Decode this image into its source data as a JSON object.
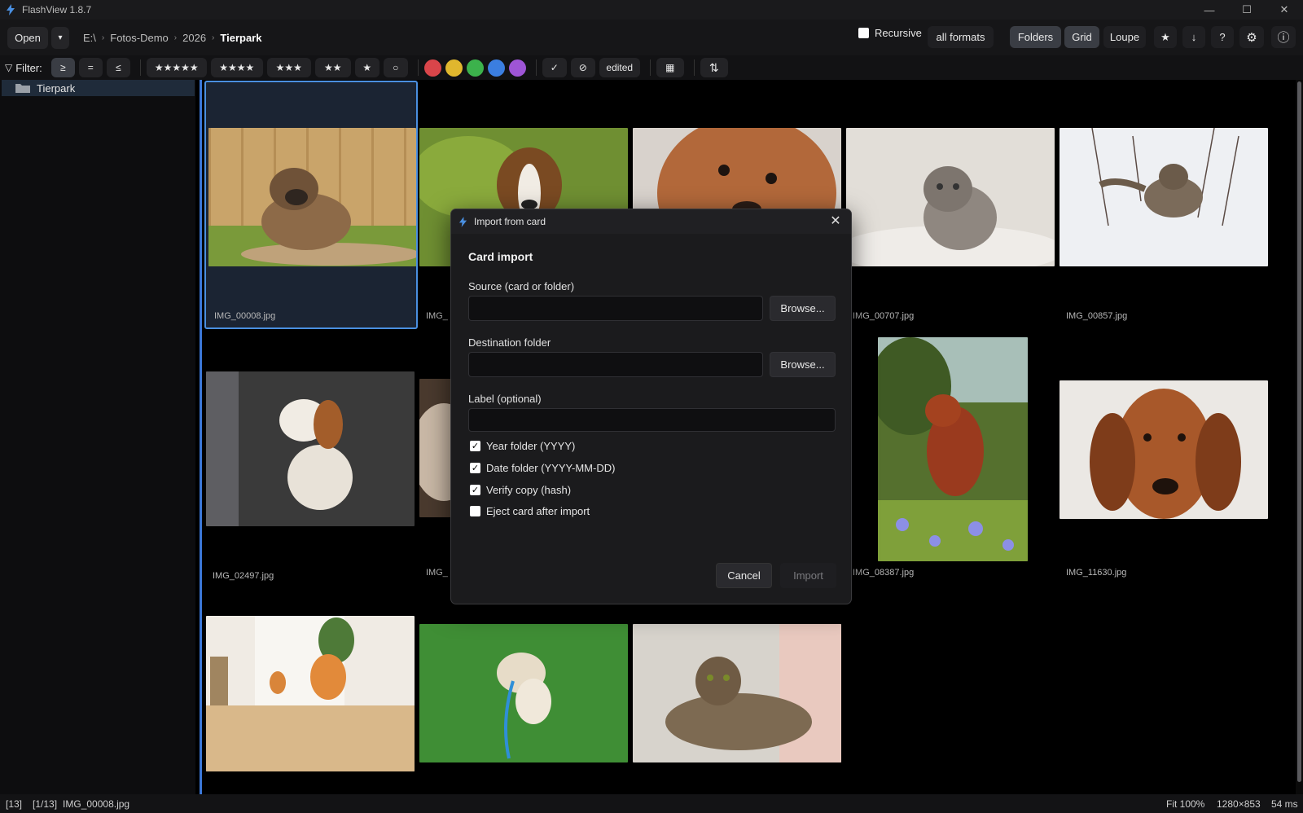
{
  "app": {
    "title": "FlashView 1.8.7"
  },
  "window_controls": {
    "minimize": "—",
    "maximize": "☐",
    "close": "✕"
  },
  "toolbar": {
    "open_label": "Open",
    "open_dropdown": "▾",
    "breadcrumbs": [
      "E:\\",
      "Fotos-Demo",
      "2026",
      "Tierpark"
    ],
    "breadcrumb_sep": "›",
    "recursive_label": "Recursive",
    "recursive_checked": false,
    "formats_label": "all formats",
    "folders_label": "Folders",
    "grid_label": "Grid",
    "loupe_label": "Loupe",
    "star_icon": "★",
    "download_icon": "↓",
    "help_icon": "?",
    "settings_icon": "⚙",
    "info_icon": "ⓘ"
  },
  "filter": {
    "label": "Filter:",
    "funnel_icon": "▽",
    "compare": [
      "≥",
      "=",
      "≤"
    ],
    "compare_active": "≥",
    "stars": [
      "★★★★★",
      "★★★★",
      "★★★",
      "★★",
      "★",
      "○"
    ],
    "colors": [
      "#d9454a",
      "#e0b72e",
      "#3cb24c",
      "#3b7ee0",
      "#9e55d6"
    ],
    "check_icon": "✓",
    "reject_icon": "⊘",
    "edited_label": "edited",
    "calendar_icon": "▦",
    "sort_icon": "⇅"
  },
  "sidebar": {
    "items": [
      {
        "label": "Tierpark"
      }
    ]
  },
  "grid": {
    "items": [
      {
        "name": "IMG_00008.jpg",
        "selected": true
      },
      {
        "name": "IMG_"
      },
      {
        "name": ""
      },
      {
        "name": "IMG_00707.jpg"
      },
      {
        "name": "IMG_00857.jpg"
      },
      {
        "name": "IMG_02497.jpg"
      },
      {
        "name": "IMG_"
      },
      {
        "name": "IMG_08387.jpg"
      },
      {
        "name": "IMG_11630.jpg"
      }
    ]
  },
  "statusbar": {
    "count": "[13]",
    "position": "[1/13]",
    "filename": "IMG_00008.jpg",
    "fit": "Fit 100%",
    "resolution": "1280×853",
    "time": "54 ms"
  },
  "dialog": {
    "title": "Import from card",
    "close_icon": "✕",
    "heading": "Card import",
    "source_label": "Source (card or folder)",
    "source_value": "",
    "destination_label": "Destination folder",
    "destination_value": "",
    "label_label": "Label (optional)",
    "label_value": "",
    "browse_label": "Browse...",
    "options": [
      {
        "label": "Year folder (YYYY)",
        "checked": true
      },
      {
        "label": "Date folder (YYYY-MM-DD)",
        "checked": true
      },
      {
        "label": "Verify copy (hash)",
        "checked": true
      },
      {
        "label": "Eject card after import",
        "checked": false
      }
    ],
    "cancel_label": "Cancel",
    "import_label": "Import"
  }
}
